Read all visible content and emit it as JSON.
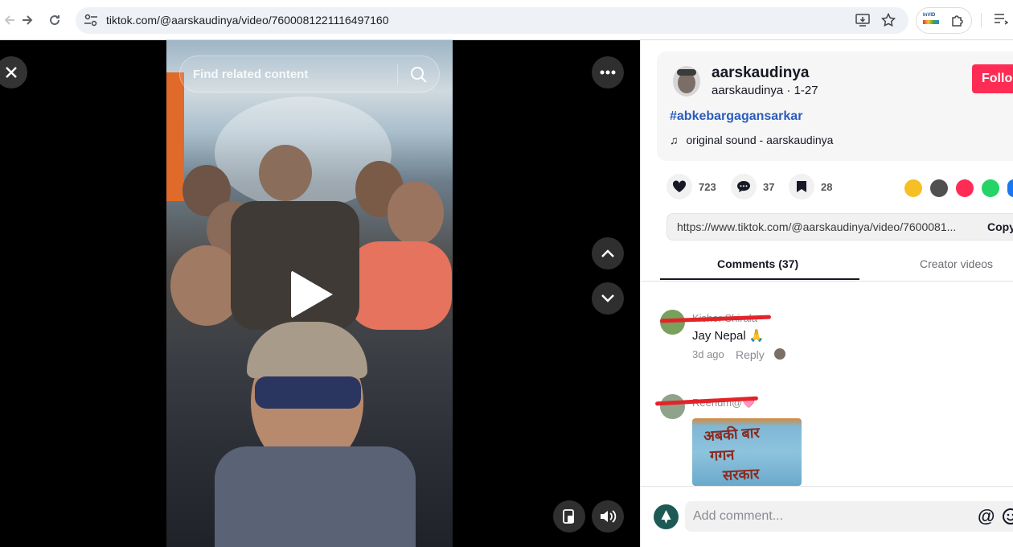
{
  "browser": {
    "url": "tiktok.com/@aarskaudinya/video/7600081221116497160",
    "extension_label": "InVID"
  },
  "video": {
    "search_placeholder": "Find related content"
  },
  "post": {
    "username": "aarskaudinya",
    "handle": "aarskaudinya",
    "date": "1-27",
    "follow_label": "Follo",
    "hashtag": "#abkebargagansarkar",
    "music": "original sound - aarskaudinya"
  },
  "stats": {
    "likes": "723",
    "comments": "37",
    "saves": "28"
  },
  "share_link": {
    "url": "https://www.tiktok.com/@aarskaudinya/video/7600081...",
    "copy_label": "Copy"
  },
  "tabs": {
    "comments": "Comments (37)",
    "creator": "Creator videos"
  },
  "comments": [
    {
      "name": "Kishor Shirala",
      "text": "Jay Nepal 🙏",
      "age": "3d ago",
      "reply": "Reply"
    },
    {
      "name": "Reenum@🩷",
      "image_text_1": "अबकी बार",
      "image_text_2": "गगन",
      "image_text_3": "सरकार"
    }
  ],
  "footer": {
    "placeholder": "Add comment...",
    "mention": "@"
  },
  "colors": {
    "accent": "#fe2c55",
    "hashtag": "#2b5db9"
  }
}
